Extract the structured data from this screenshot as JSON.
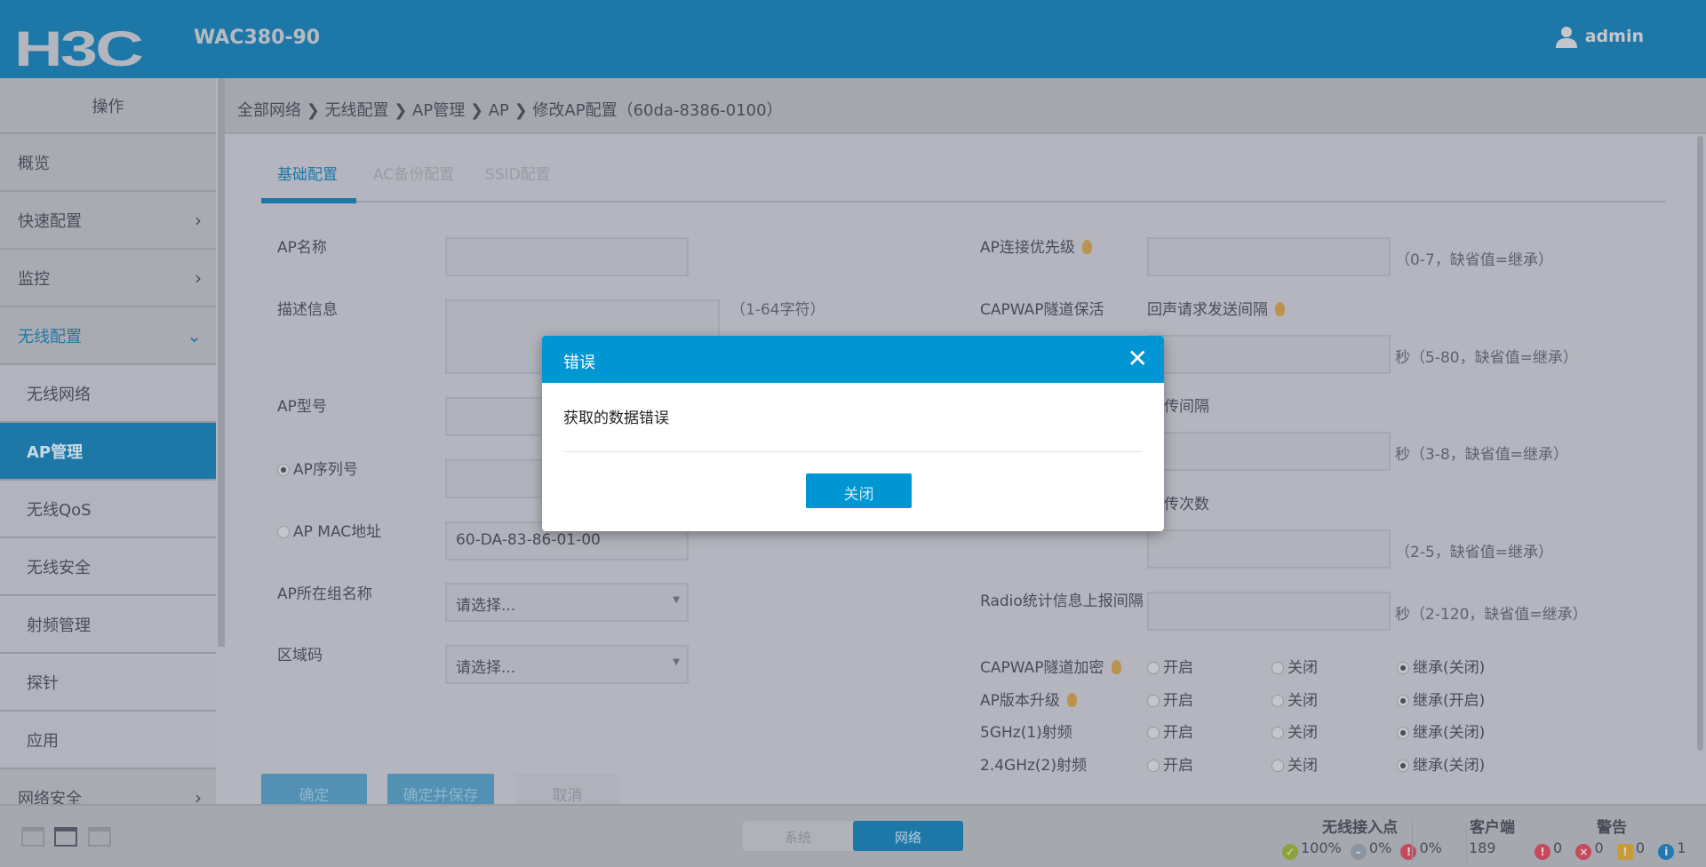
{
  "header": {
    "logo": "H3C",
    "model": "WAC380-90",
    "user": "admin"
  },
  "sidebar": {
    "title": "操作",
    "items": [
      {
        "label": "概览",
        "chevron": "›"
      },
      {
        "label": "快速配置",
        "chevron": "›"
      },
      {
        "label": "监控",
        "chevron": "›"
      },
      {
        "label": "无线配置",
        "chevron": "⌄"
      },
      {
        "label": "无线网络"
      },
      {
        "label": "AP管理"
      },
      {
        "label": "无线QoS"
      },
      {
        "label": "无线安全"
      },
      {
        "label": "射频管理"
      },
      {
        "label": "探针"
      },
      {
        "label": "应用"
      },
      {
        "label": "网络安全",
        "chevron": "›"
      }
    ]
  },
  "breadcrumb": "全部网络 ❯ 无线配置 ❯ AP管理 ❯ AP ❯ 修改AP配置（60da-8386-0100）",
  "tabs": [
    "基础配置",
    "AC备份配置",
    "SSID配置"
  ],
  "form_left": {
    "ap_name": "AP名称",
    "description": "描述信息",
    "description_hint": "（1-64字符）",
    "ap_model": "AP型号",
    "ap_serial": "AP序列号",
    "ap_mac": "AP MAC地址",
    "ap_mac_value": "60-DA-83-86-01-00",
    "ap_group": "AP所在组名称",
    "ap_group_value": "请选择...",
    "region": "区域码",
    "region_value": "请选择..."
  },
  "form_right": {
    "priority": "AP连接优先级",
    "priority_hint": "（0-7，缺省值=继承）",
    "keepalive": "CAPWAP隧道保活",
    "echo_interval": "回声请求发送间隔",
    "echo_hint": "秒（5-80，缺省值=继承）",
    "retrans_interval": "传间隔",
    "retrans_interval_hint": "秒（3-8，缺省值=继承）",
    "retrans_count": "传次数",
    "retrans_count_hint": "（2-5，缺省值=继承）",
    "radio_stats": "Radio统计信息上报间隔",
    "radio_stats_hint": "秒（2-120，缺省值=继承）",
    "radio_rows": [
      {
        "label": "CAPWAP隧道加密",
        "bulb": true,
        "opts": [
          "开启",
          "关闭",
          "继承(关闭)"
        ]
      },
      {
        "label": "AP版本升级",
        "bulb": true,
        "opts": [
          "开启",
          "关闭",
          "继承(开启)"
        ]
      },
      {
        "label": "5GHz(1)射频",
        "bulb": false,
        "opts": [
          "开启",
          "关闭",
          "继承(关闭)"
        ]
      },
      {
        "label": "2.4GHz(2)射频",
        "bulb": false,
        "opts": [
          "开启",
          "关闭",
          "继承(关闭)"
        ]
      }
    ]
  },
  "buttons": {
    "ok": "确定",
    "ok_save": "确定并保存",
    "cancel": "取消"
  },
  "dialog": {
    "title": "错误",
    "message": "获取的数据错误",
    "close_label": "关闭",
    "close_icon": "✕"
  },
  "bottom": {
    "toggle": [
      "系统",
      "网络"
    ],
    "ap_title": "无线接入点",
    "ap_online": "100%",
    "ap_idle": "0%",
    "ap_fault": "0%",
    "client_title": "客户端",
    "clients": "189",
    "alarm_title": "警告",
    "alarm_critical": "0",
    "alarm_error": "0",
    "alarm_warning": "0",
    "alarm_info": "1"
  }
}
